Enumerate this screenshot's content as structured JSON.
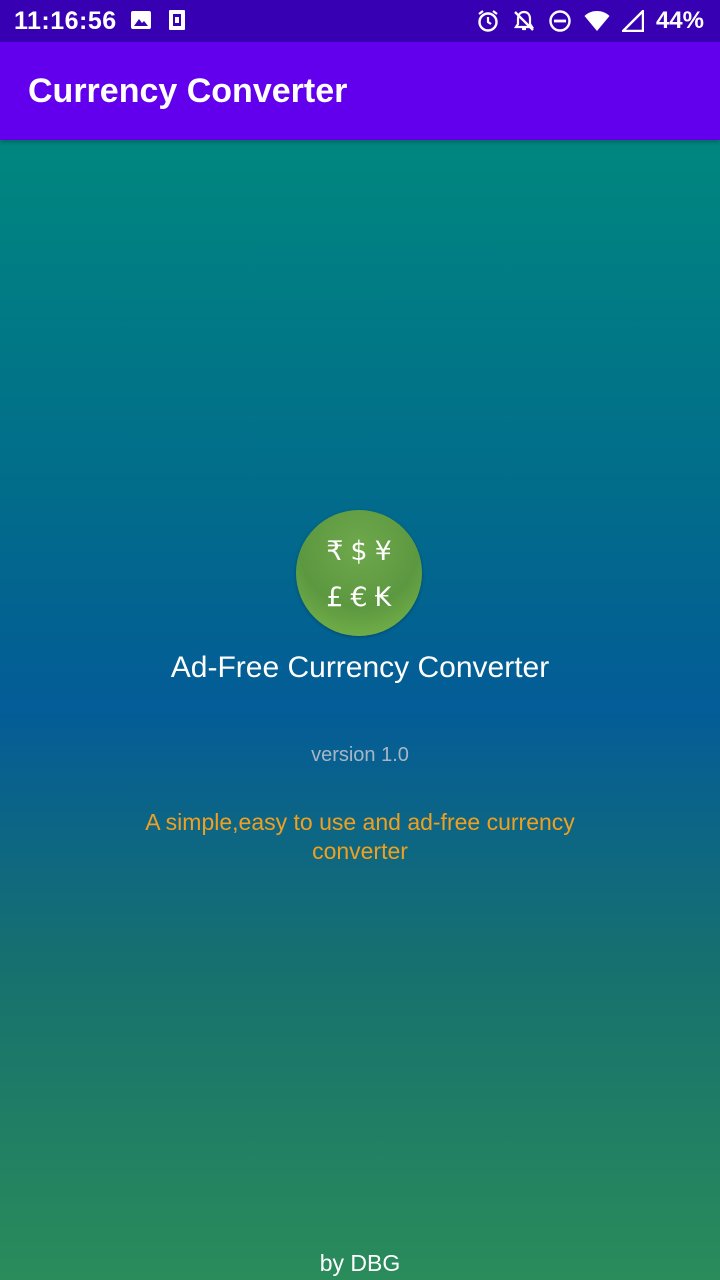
{
  "status_bar": {
    "time": "11:16:56",
    "battery": "44%",
    "icons": [
      "image-icon",
      "sim-card-icon",
      "alarm-icon",
      "notifications-off-icon",
      "do-not-disturb-icon",
      "wifi-icon",
      "signal-icon"
    ]
  },
  "app_bar": {
    "title": "Currency Converter"
  },
  "about": {
    "logo_row_1": "₹$¥",
    "logo_row_2": "£€₭",
    "app_name": "Ad-Free Currency Converter",
    "version": "version 1.0",
    "tagline": "A simple,easy to use and ad-free currency converter",
    "author": "by DBG"
  },
  "colors": {
    "status_bar": "#3700b3",
    "app_bar": "#6200ee",
    "gradient_top": "#00877f",
    "gradient_middle": "#045c98",
    "gradient_bottom": "#2a8c5a",
    "tagline": "#f0a020",
    "logo": "#6fa84c"
  }
}
